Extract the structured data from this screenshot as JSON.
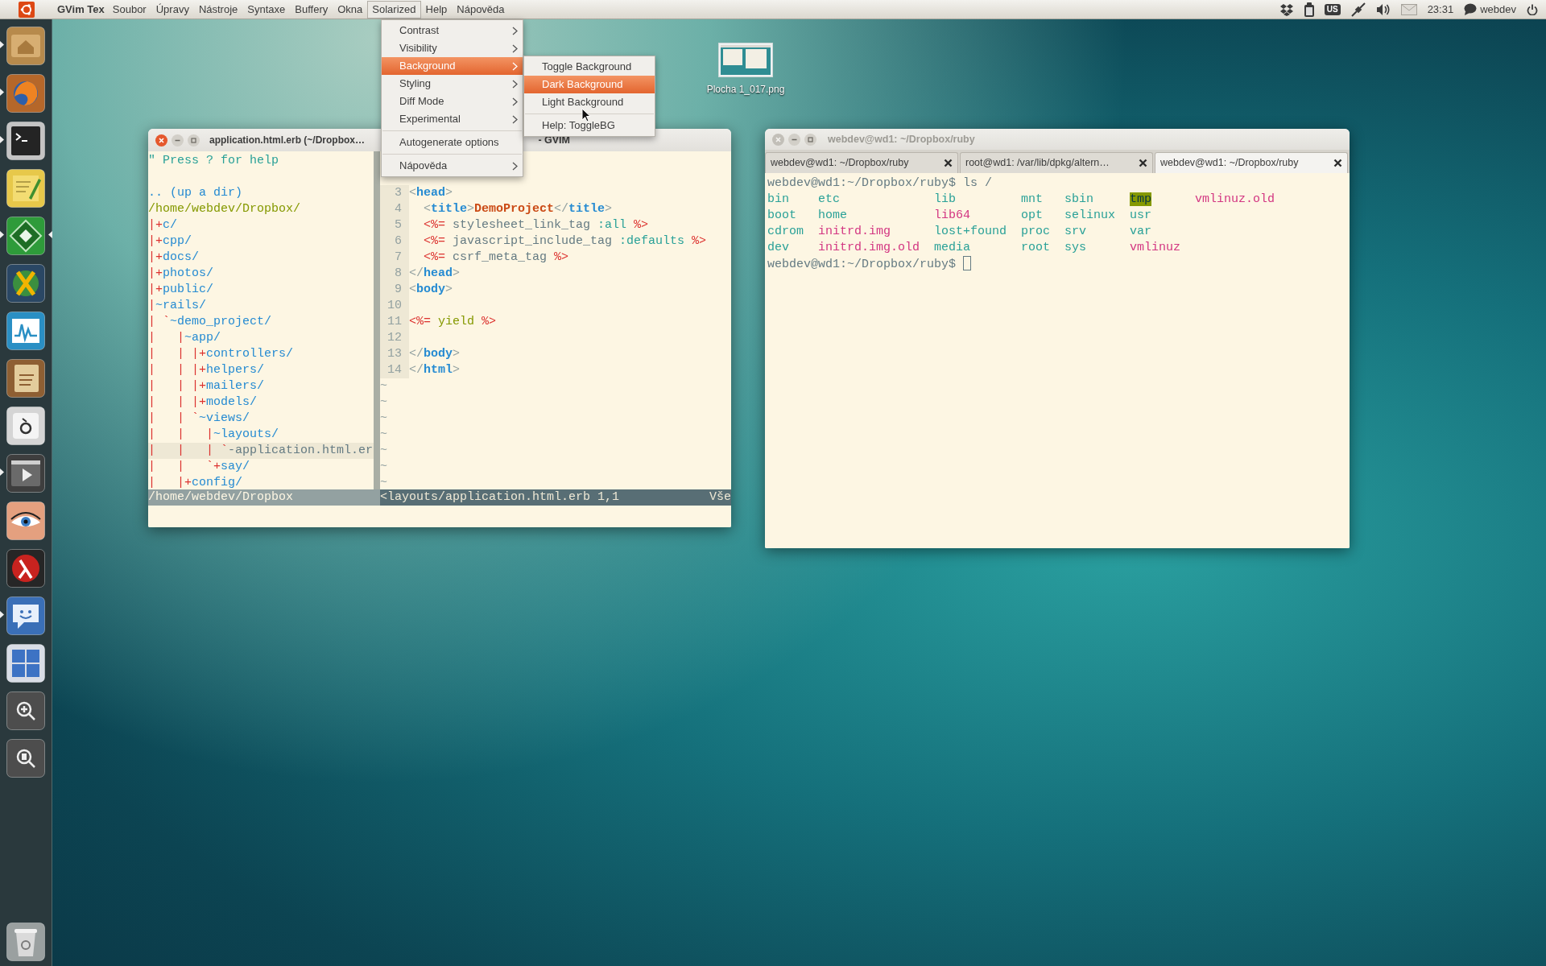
{
  "top_panel": {
    "app_title": "GVim Tex",
    "menus": [
      {
        "label": "Soubor",
        "selected": false
      },
      {
        "label": "Úpravy",
        "selected": false
      },
      {
        "label": "Nástroje",
        "selected": false
      },
      {
        "label": "Syntaxe",
        "selected": false
      },
      {
        "label": "Buffery",
        "selected": false
      },
      {
        "label": "Okna",
        "selected": false
      },
      {
        "label": "Solarized",
        "selected": true
      },
      {
        "label": "Help",
        "selected": false
      },
      {
        "label": "Nápověda",
        "selected": false
      }
    ],
    "keyboard_layout": "US",
    "clock": "23:31",
    "user": "webdev"
  },
  "launcher": {
    "items": [
      {
        "kind": "files",
        "running": true,
        "active": false
      },
      {
        "kind": "browser",
        "running": true,
        "active": false
      },
      {
        "kind": "terminal",
        "running": true,
        "active": false
      },
      {
        "kind": "notes",
        "running": false,
        "active": false
      },
      {
        "kind": "editor",
        "running": true,
        "active": true
      },
      {
        "kind": "globe",
        "running": false,
        "active": false
      },
      {
        "kind": "monitor",
        "running": false,
        "active": false
      },
      {
        "kind": "dictionary",
        "running": false,
        "active": false
      },
      {
        "kind": "charmap",
        "running": false,
        "active": false
      },
      {
        "kind": "video",
        "running": true,
        "active": false
      },
      {
        "kind": "eye",
        "running": false,
        "active": false
      },
      {
        "kind": "lambda",
        "running": false,
        "active": false
      },
      {
        "kind": "chat",
        "running": true,
        "active": false
      },
      {
        "kind": "workspaces",
        "running": false,
        "active": false
      },
      {
        "kind": "zoom",
        "running": false,
        "active": false
      },
      {
        "kind": "zoomdoc",
        "running": false,
        "active": false
      },
      {
        "kind": "trash",
        "running": false,
        "active": false
      }
    ]
  },
  "desktop_icons": [
    {
      "label": "Plocha 1_017.png"
    }
  ],
  "gvim": {
    "title": "application.html.erb (~/Dropbox…",
    "title_suffix": "- GVIM",
    "focused": true,
    "tree": [
      {
        "kind": "help",
        "segments": [
          {
            "text": "\" Press ? for help",
            "kind": "comment"
          }
        ]
      },
      {
        "kind": "blank"
      },
      {
        "kind": "entry",
        "selected": false,
        "segments": [
          {
            "text": ".. (up a dir)",
            "kind": "dir"
          }
        ]
      },
      {
        "kind": "entry",
        "selected": false,
        "segments": [
          {
            "text": "/home/webdev/Dropbox/",
            "kind": "root"
          }
        ]
      },
      {
        "kind": "entry",
        "selected": false,
        "segments": [
          {
            "text": "|+",
            "kind": "mark"
          },
          {
            "text": "c/",
            "kind": "dir"
          }
        ]
      },
      {
        "kind": "entry",
        "selected": false,
        "segments": [
          {
            "text": "|+",
            "kind": "mark"
          },
          {
            "text": "cpp/",
            "kind": "dir"
          }
        ]
      },
      {
        "kind": "entry",
        "selected": false,
        "segments": [
          {
            "text": "|+",
            "kind": "mark"
          },
          {
            "text": "docs/",
            "kind": "dir"
          }
        ]
      },
      {
        "kind": "entry",
        "selected": false,
        "segments": [
          {
            "text": "|+",
            "kind": "mark"
          },
          {
            "text": "photos/",
            "kind": "dir"
          }
        ]
      },
      {
        "kind": "entry",
        "selected": false,
        "segments": [
          {
            "text": "|+",
            "kind": "mark"
          },
          {
            "text": "public/",
            "kind": "dir"
          }
        ]
      },
      {
        "kind": "entry",
        "selected": false,
        "segments": [
          {
            "text": "|",
            "kind": "mark"
          },
          {
            "text": "~rails/",
            "kind": "dir"
          }
        ]
      },
      {
        "kind": "entry",
        "selected": false,
        "segments": [
          {
            "text": "| `",
            "kind": "mark"
          },
          {
            "text": "~demo_project/",
            "kind": "dir"
          }
        ]
      },
      {
        "kind": "entry",
        "selected": false,
        "segments": [
          {
            "text": "|   |",
            "kind": "mark"
          },
          {
            "text": "~app/",
            "kind": "dir"
          }
        ]
      },
      {
        "kind": "entry",
        "selected": false,
        "segments": [
          {
            "text": "|   | |+",
            "kind": "mark"
          },
          {
            "text": "controllers/",
            "kind": "dir"
          }
        ]
      },
      {
        "kind": "entry",
        "selected": false,
        "segments": [
          {
            "text": "|   | |+",
            "kind": "mark"
          },
          {
            "text": "helpers/",
            "kind": "dir"
          }
        ]
      },
      {
        "kind": "entry",
        "selected": false,
        "segments": [
          {
            "text": "|   | |+",
            "kind": "mark"
          },
          {
            "text": "mailers/",
            "kind": "dir"
          }
        ]
      },
      {
        "kind": "entry",
        "selected": false,
        "segments": [
          {
            "text": "|   | |+",
            "kind": "mark"
          },
          {
            "text": "models/",
            "kind": "dir"
          }
        ]
      },
      {
        "kind": "entry",
        "selected": false,
        "segments": [
          {
            "text": "|   | `",
            "kind": "mark"
          },
          {
            "text": "~views/",
            "kind": "dir"
          }
        ]
      },
      {
        "kind": "entry",
        "selected": false,
        "segments": [
          {
            "text": "|   |   |",
            "kind": "mark"
          },
          {
            "text": "~layouts/",
            "kind": "dir"
          }
        ]
      },
      {
        "kind": "entry",
        "selected": true,
        "segments": [
          {
            "text": "|   |   | `",
            "kind": "mark"
          },
          {
            "text": "-application.html.er",
            "kind": "file"
          }
        ]
      },
      {
        "kind": "entry",
        "selected": false,
        "segments": [
          {
            "text": "|   |   `+",
            "kind": "mark"
          },
          {
            "text": "say/",
            "kind": "dir"
          }
        ]
      },
      {
        "kind": "entry",
        "selected": false,
        "segments": [
          {
            "text": "|   |+",
            "kind": "mark"
          },
          {
            "text": "config/",
            "kind": "dir"
          }
        ]
      }
    ],
    "tree_status": "/home/webdev/Dropbox",
    "code": [
      {
        "kind": "line",
        "number": "3",
        "segments": [
          {
            "text": "<",
            "kind": "punct"
          },
          {
            "text": "head",
            "kind": "tag"
          },
          {
            "text": ">",
            "kind": "punct"
          }
        ]
      },
      {
        "kind": "line",
        "number": "4",
        "segments": [
          {
            "text": "  <",
            "kind": "punct"
          },
          {
            "text": "title",
            "kind": "tag"
          },
          {
            "text": ">",
            "kind": "punct"
          },
          {
            "text": "DemoProject",
            "kind": "title"
          },
          {
            "text": "</",
            "kind": "punct"
          },
          {
            "text": "title",
            "kind": "tag"
          },
          {
            "text": ">",
            "kind": "punct"
          }
        ]
      },
      {
        "kind": "line",
        "number": "5",
        "segments": [
          {
            "text": "  <%=",
            "kind": "erb"
          },
          {
            "text": " stylesheet_link_tag ",
            "kind": "plain"
          },
          {
            "text": ":all",
            "kind": "symbol"
          },
          {
            "text": " %>",
            "kind": "erb"
          }
        ]
      },
      {
        "kind": "line",
        "number": "6",
        "segments": [
          {
            "text": "  <%=",
            "kind": "erb"
          },
          {
            "text": " javascript_include_tag ",
            "kind": "plain"
          },
          {
            "text": ":defaults",
            "kind": "symbol"
          },
          {
            "text": " %>",
            "kind": "erb"
          }
        ]
      },
      {
        "kind": "line",
        "number": "7",
        "segments": [
          {
            "text": "  <%=",
            "kind": "erb"
          },
          {
            "text": " csrf_meta_tag ",
            "kind": "plain"
          },
          {
            "text": "%>",
            "kind": "erb"
          }
        ]
      },
      {
        "kind": "line",
        "number": "8",
        "segments": [
          {
            "text": "</",
            "kind": "punct"
          },
          {
            "text": "head",
            "kind": "tag"
          },
          {
            "text": ">",
            "kind": "punct"
          }
        ]
      },
      {
        "kind": "line",
        "number": "9",
        "segments": [
          {
            "text": "<",
            "kind": "punct"
          },
          {
            "text": "body",
            "kind": "tag"
          },
          {
            "text": ">",
            "kind": "punct"
          }
        ]
      },
      {
        "kind": "line",
        "number": "10"
      },
      {
        "kind": "line",
        "number": "11",
        "segments": [
          {
            "text": "<%=",
            "kind": "erb"
          },
          {
            "text": " yield ",
            "kind": "keyword"
          },
          {
            "text": "%>",
            "kind": "erb"
          }
        ]
      },
      {
        "kind": "line",
        "number": "12"
      },
      {
        "kind": "line",
        "number": "13",
        "segments": [
          {
            "text": "</",
            "kind": "punct"
          },
          {
            "text": "body",
            "kind": "tag"
          },
          {
            "text": ">",
            "kind": "punct"
          }
        ]
      },
      {
        "kind": "line",
        "number": "14",
        "segments": [
          {
            "text": "</",
            "kind": "punct"
          },
          {
            "text": "html",
            "kind": "tag"
          },
          {
            "text": ">",
            "kind": "punct"
          }
        ]
      },
      {
        "kind": "filler",
        "text": "~"
      },
      {
        "kind": "filler",
        "text": "~"
      },
      {
        "kind": "filler",
        "text": "~"
      },
      {
        "kind": "filler",
        "text": "~"
      },
      {
        "kind": "filler",
        "text": "~"
      },
      {
        "kind": "filler",
        "text": "~"
      },
      {
        "kind": "filler",
        "text": "~"
      }
    ],
    "status": "<layouts/application.html.erb 1,1",
    "status_right": "Vše"
  },
  "menu": {
    "items": [
      {
        "kind": "item",
        "label": "Contrast",
        "submenu": true,
        "selected": false
      },
      {
        "kind": "item",
        "label": "Visibility",
        "submenu": true,
        "selected": false
      },
      {
        "kind": "item",
        "label": "Background",
        "submenu": true,
        "selected": true
      },
      {
        "kind": "item",
        "label": "Styling",
        "submenu": true,
        "selected": false
      },
      {
        "kind": "item",
        "label": "Diff Mode",
        "submenu": true,
        "selected": false
      },
      {
        "kind": "item",
        "label": "Experimental",
        "submenu": true,
        "selected": false
      },
      {
        "kind": "separator"
      },
      {
        "kind": "item",
        "label": "Autogenerate options",
        "submenu": false,
        "selected": false
      },
      {
        "kind": "separator"
      },
      {
        "kind": "item",
        "label": "Nápověda",
        "submenu": true,
        "selected": false
      }
    ]
  },
  "submenu": {
    "items": [
      {
        "kind": "item",
        "label": "Toggle Background",
        "selected": false
      },
      {
        "kind": "item",
        "label": "Dark Background",
        "selected": true
      },
      {
        "kind": "item",
        "label": "Light Background",
        "selected": false
      },
      {
        "kind": "separator"
      },
      {
        "kind": "item",
        "label": "Help: ToggleBG",
        "selected": false
      }
    ]
  },
  "terminal": {
    "title": "webdev@wd1: ~/Dropbox/ruby",
    "focused": false,
    "tabs": [
      {
        "label": "webdev@wd1: ~/Dropbox/ruby",
        "selected": false
      },
      {
        "label": "root@wd1: /var/lib/dpkg/altern…",
        "selected": false
      },
      {
        "label": "webdev@wd1: ~/Dropbox/ruby",
        "selected": true
      }
    ],
    "lines": [
      {
        "kind": "command",
        "text": "webdev@wd1:~/Dropbox/ruby$ ls /",
        "cursor": false
      },
      {
        "kind": "listing",
        "rows": [
          [
            {
              "name": "bin",
              "kind": "dir"
            },
            {
              "name": "etc",
              "kind": "dir"
            },
            {
              "name": "lib",
              "kind": "dir"
            },
            {
              "name": "mnt",
              "kind": "dir"
            },
            {
              "name": "sbin",
              "kind": "dir"
            },
            {
              "name": "tmp",
              "kind": "sticky"
            },
            {
              "name": "vmlinuz.old",
              "kind": "link"
            }
          ],
          [
            {
              "name": "boot",
              "kind": "dir"
            },
            {
              "name": "home",
              "kind": "dir"
            },
            {
              "name": "lib64",
              "kind": "link"
            },
            {
              "name": "opt",
              "kind": "dir"
            },
            {
              "name": "selinux",
              "kind": "dir"
            },
            {
              "name": "usr",
              "kind": "dir"
            }
          ],
          [
            {
              "name": "cdrom",
              "kind": "dir"
            },
            {
              "name": "initrd.img",
              "kind": "link"
            },
            {
              "name": "lost+found",
              "kind": "dir"
            },
            {
              "name": "proc",
              "kind": "dir"
            },
            {
              "name": "srv",
              "kind": "dir"
            },
            {
              "name": "var",
              "kind": "dir"
            }
          ],
          [
            {
              "name": "dev",
              "kind": "dir"
            },
            {
              "name": "initrd.img.old",
              "kind": "link"
            },
            {
              "name": "media",
              "kind": "dir"
            },
            {
              "name": "root",
              "kind": "dir"
            },
            {
              "name": "sys",
              "kind": "dir"
            },
            {
              "name": "vmlinuz",
              "kind": "link"
            }
          ]
        ]
      },
      {
        "kind": "command",
        "text": "webdev@wd1:~/Dropbox/ruby$",
        "cursor": true
      }
    ]
  }
}
